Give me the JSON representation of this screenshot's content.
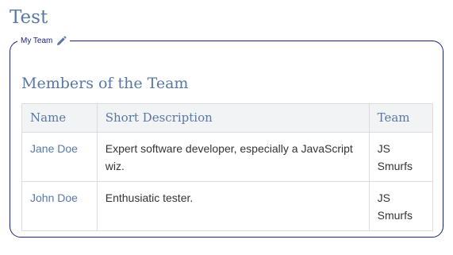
{
  "page": {
    "title": "Test"
  },
  "fieldset": {
    "legend": "My Team",
    "edit_icon": "pencil-icon"
  },
  "section": {
    "heading": "Members of the Team"
  },
  "table": {
    "headers": [
      "Name",
      "Short Description",
      "Team"
    ],
    "rows": [
      {
        "name": "Jane Doe",
        "description": "Expert software developer, especially a JavaScript wiz.",
        "team": "JS Smurfs"
      },
      {
        "name": "John Doe",
        "description": "Enthusiatic tester.",
        "team": "JS Smurfs"
      }
    ]
  },
  "colors": {
    "heading": "#5a77a3",
    "border": "#1a237e",
    "header_bg": "#f2f3f5"
  }
}
